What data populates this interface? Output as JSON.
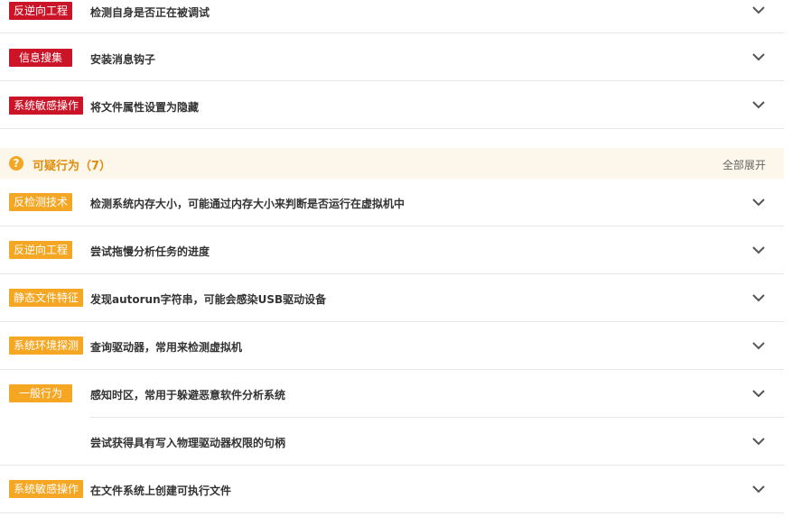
{
  "top_items": [
    {
      "tag": "反逆向工程",
      "desc": "检测自身是否正在被调试",
      "color": "#cc1428"
    },
    {
      "tag": "信息搜集",
      "desc": "安装消息钩子",
      "color": "#cc1428"
    },
    {
      "tag": "系统敏感操作",
      "desc": "将文件属性设置为隐藏",
      "color": "#cc1428"
    }
  ],
  "suspicious": {
    "title": "可疑行为（7）",
    "expand_all": "全部展开",
    "icon": "question-circle-icon",
    "accent": "#f5a623",
    "items": [
      {
        "tag": "反检测技术",
        "desc": "检测系统内存大小，可能通过内存大小来判断是否运行在虚拟机中"
      },
      {
        "tag": "反逆向工程",
        "desc": "尝试拖慢分析任务的进度"
      },
      {
        "tag": "静态文件特征",
        "desc": "发现autorun字符串，可能会感染USB驱动设备"
      },
      {
        "tag": "系统环境探测",
        "desc": "查询驱动器，常用来检测虚拟机"
      },
      {
        "tag": "一般行为",
        "desc": "感知时区，常用于躲避恶意软件分析系统"
      },
      {
        "tag": "",
        "desc": "尝试获得具有写入物理驱动器权限的句柄"
      },
      {
        "tag": "系统敏感操作",
        "desc": "在文件系统上创建可执行文件"
      }
    ]
  }
}
